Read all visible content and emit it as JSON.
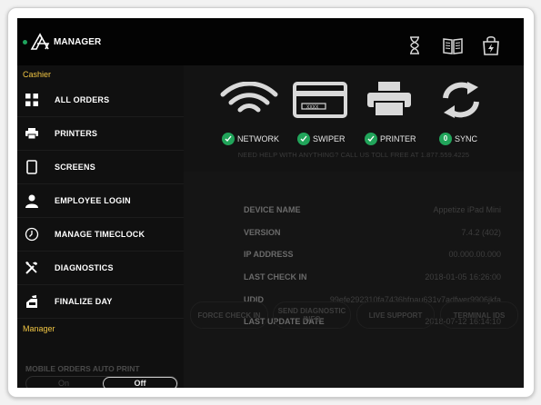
{
  "header": {
    "app_title": "MANAGER",
    "status_color": "#1fa35d",
    "icons": [
      "hourglass-icon",
      "book-icon",
      "shopping-bag-lightning-icon"
    ]
  },
  "sidebar": {
    "cashier_section": "Cashier",
    "items": [
      {
        "label": "ALL ORDERS",
        "icon": "grid-icon"
      },
      {
        "label": "PRINTERS",
        "icon": "printer-icon"
      },
      {
        "label": "SCREENS",
        "icon": "tablet-icon"
      },
      {
        "label": "EMPLOYEE LOGIN",
        "icon": "person-icon"
      },
      {
        "label": "MANAGE TIMECLOCK",
        "icon": "clock-icon"
      },
      {
        "label": "DIAGNOSTICS",
        "icon": "tools-icon"
      },
      {
        "label": "FINALIZE DAY",
        "icon": "register-icon"
      }
    ],
    "manager_section": "Manager",
    "auto_print": {
      "label": "MOBILE ORDERS AUTO PRINT",
      "off_label": "On",
      "on_label": "Off",
      "selected": "Off"
    }
  },
  "status": {
    "items": [
      {
        "label": "NETWORK",
        "icon": "wifi-icon",
        "state": "ok"
      },
      {
        "label": "SWIPER",
        "icon": "card-icon",
        "state": "ok"
      },
      {
        "label": "PRINTER",
        "icon": "printer-icon",
        "state": "ok"
      },
      {
        "label": "SYNC",
        "icon": "sync-icon",
        "count": "0"
      }
    ],
    "help_text": "NEED HELP WITH ANYTHING? CALL US TOLL FREE AT 1.877.559.4225"
  },
  "device_info": {
    "rows": [
      {
        "key": "DEVICE NAME",
        "value": "Appetize iPad Mini"
      },
      {
        "key": "VERSION",
        "value": "7.4.2 (402)"
      },
      {
        "key": "IP ADDRESS",
        "value": "00.000.00.000"
      },
      {
        "key": "LAST CHECK IN",
        "value": "2018-01-05 16:26:00"
      },
      {
        "key": "UDID",
        "value": "99efe292310fa7436hfnau631v7adfwer9906jkfa"
      },
      {
        "key": "LAST UPDATE DATE",
        "value": "2018-07-12 16:14:10"
      }
    ]
  },
  "actions": {
    "force_check_in": "FORCE CHECK IN",
    "send_diagnostic": "SEND DIAGNOSTIC INFO",
    "live_support": "LIVE SUPPORT",
    "terminal_ids": "TERMINAL IDS"
  },
  "colors": {
    "accent_yellow": "#f1c644",
    "success_green": "#21a45a",
    "background": "#151515"
  }
}
